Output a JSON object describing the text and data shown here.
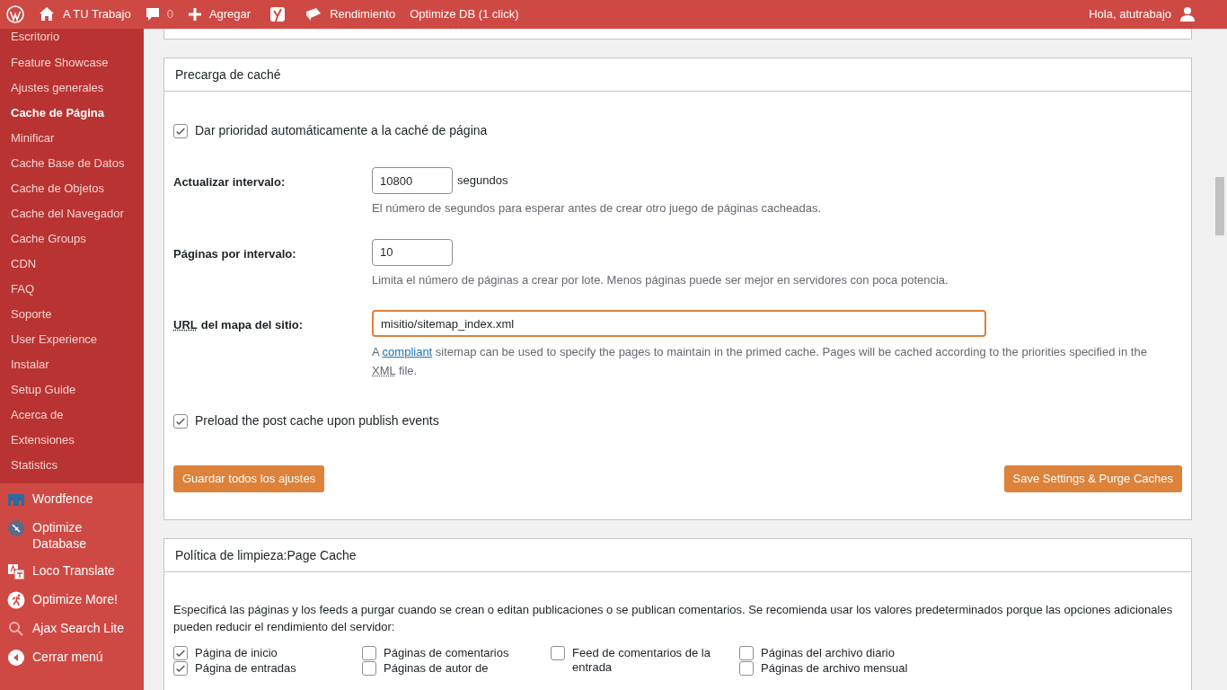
{
  "admin_bar": {
    "site": "A TU Trabajo",
    "comments": "0",
    "add": "Agregar",
    "performance": "Rendimiento",
    "optimize": "Optimize DB (1 click)",
    "greeting": "Hola, atutrabajo"
  },
  "sidebar": {
    "submenu": [
      {
        "label": "Escritorio",
        "selected": false
      },
      {
        "label": "Feature Showcase",
        "selected": false
      },
      {
        "label": "Ajustes generales",
        "selected": false
      },
      {
        "label": "Cache de Página",
        "selected": true
      },
      {
        "label": "Minificar",
        "selected": false
      },
      {
        "label": "Cache Base de Datos",
        "selected": false
      },
      {
        "label": "Cache de Objetos",
        "selected": false
      },
      {
        "label": "Cache del Navegador",
        "selected": false
      },
      {
        "label": "Cache Groups",
        "selected": false
      },
      {
        "label": "CDN",
        "selected": false
      },
      {
        "label": "FAQ",
        "selected": false
      },
      {
        "label": "Soporte",
        "selected": false
      },
      {
        "label": "User Experience",
        "selected": false
      },
      {
        "label": "Instalar",
        "selected": false
      },
      {
        "label": "Setup Guide",
        "selected": false
      },
      {
        "label": "Acerca de",
        "selected": false
      },
      {
        "label": "Extensiones",
        "selected": false
      },
      {
        "label": "Statistics",
        "selected": false
      }
    ],
    "menu": [
      {
        "label": "Wordfence",
        "kind": "wordfence"
      },
      {
        "label": "Optimize Database",
        "kind": "broom"
      },
      {
        "label": "Loco Translate",
        "kind": "translate"
      },
      {
        "label": "Optimize More!",
        "kind": "runner"
      },
      {
        "label": "Ajax Search Lite",
        "kind": "search"
      },
      {
        "label": "Cerrar menú",
        "kind": "collapse"
      }
    ]
  },
  "preload_panel": {
    "title": "Precarga de caché",
    "auto_priority": {
      "label": "Dar prioridad automáticamente a la caché de página",
      "checked": true
    },
    "interval": {
      "label": "Actualizar intervalo:",
      "value": "10800",
      "unit": "segundos",
      "help": "El número de segundos para esperar antes de crear otro juego de páginas cacheadas."
    },
    "pages": {
      "label": "Páginas por intervalo:",
      "value": "10",
      "help": "Limita el número de páginas a crear por lote. Menos páginas puede ser mejor en servidores con poca potencia."
    },
    "sitemap": {
      "label_abbr": "URL",
      "label_rest": "del mapa del sitio:",
      "value": "misitio/sitemap_index.xml",
      "help_before": "A",
      "help_link": "compliant",
      "help_after": "sitemap can be used to specify the pages to maintain in the primed cache. Pages will be cached according to the priorities specified in the",
      "help_abbr": "XML",
      "help_end": "file."
    },
    "preload_post": {
      "label": "Preload the post cache upon publish events",
      "checked": true
    },
    "buttons": [
      "Guardar todos los ajustes",
      "Save Settings & Purge Caches"
    ]
  },
  "purge_panel": {
    "title": "Política de limpieza:Page Cache",
    "intro": "Especificá las páginas y los feeds a purgar cuando se crean o editan publicaciones o se publican comentarios. Se recomienda usar los valores predeterminados porque las opciones adicionales pueden reducir el rendimiento del servidor:",
    "columns": [
      [
        {
          "label": "Página de inicio",
          "checked": true
        },
        {
          "label": "Página de entradas",
          "checked": true
        }
      ],
      [
        {
          "label": "Páginas de comentarios",
          "checked": false
        },
        {
          "label": "Páginas de autor de",
          "checked": false
        }
      ],
      [
        {
          "label": "Feed de comentarios de la entrada",
          "checked": false
        }
      ],
      [
        {
          "label": "Páginas del archivo diario",
          "checked": false
        },
        {
          "label": "Páginas de archivo mensual",
          "checked": false
        }
      ]
    ]
  }
}
